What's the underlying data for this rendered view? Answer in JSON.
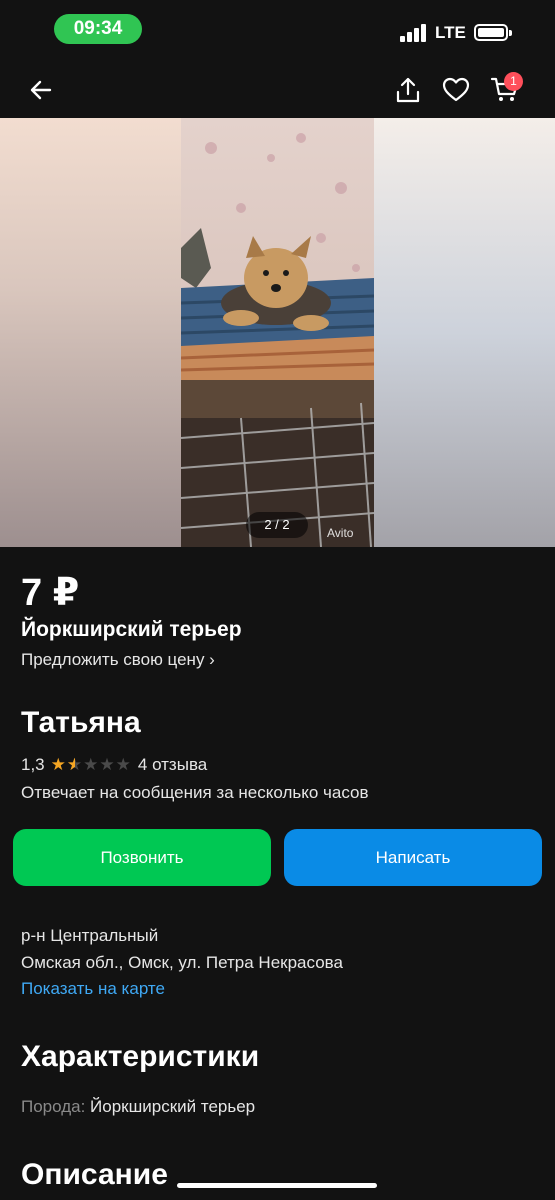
{
  "status_bar": {
    "time": "09:34",
    "network": "LTE",
    "icons": [
      "signal-icon",
      "battery-icon"
    ]
  },
  "toolbar": {
    "icons": [
      "back-arrow-icon",
      "share-icon",
      "heart-icon",
      "cart-icon"
    ],
    "cart_badge": "1"
  },
  "gallery": {
    "counter": "2 / 2",
    "watermark": "Avito"
  },
  "listing": {
    "price": "7 ₽",
    "title": "Йоркширский терьер",
    "offer_label": "Предложить свою цену ›"
  },
  "seller": {
    "name": "Татьяна",
    "rating": "1,3",
    "rating_value": 1.3,
    "rating_max": 5,
    "reviews": "4 отзыва",
    "response_time": "Отвечает на сообщения за несколько часов"
  },
  "actions": {
    "call_label": "Позвонить",
    "write_label": "Написать"
  },
  "location": {
    "district": "р-н Центральный",
    "address": "Омская обл., Омск, ул. Петра Некрасова",
    "map_link": "Показать на карте"
  },
  "characteristics": {
    "heading": "Характеристики",
    "items": [
      {
        "key": "Порода:",
        "value": "Йоркширский терьер"
      }
    ]
  },
  "description": {
    "heading": "Описание"
  },
  "colors": {
    "background": "#121212",
    "call_button": "#00c853",
    "write_button": "#0a8be6",
    "link": "#3fa9f5",
    "star": "#f5a623",
    "badge": "#ff4f5b"
  }
}
